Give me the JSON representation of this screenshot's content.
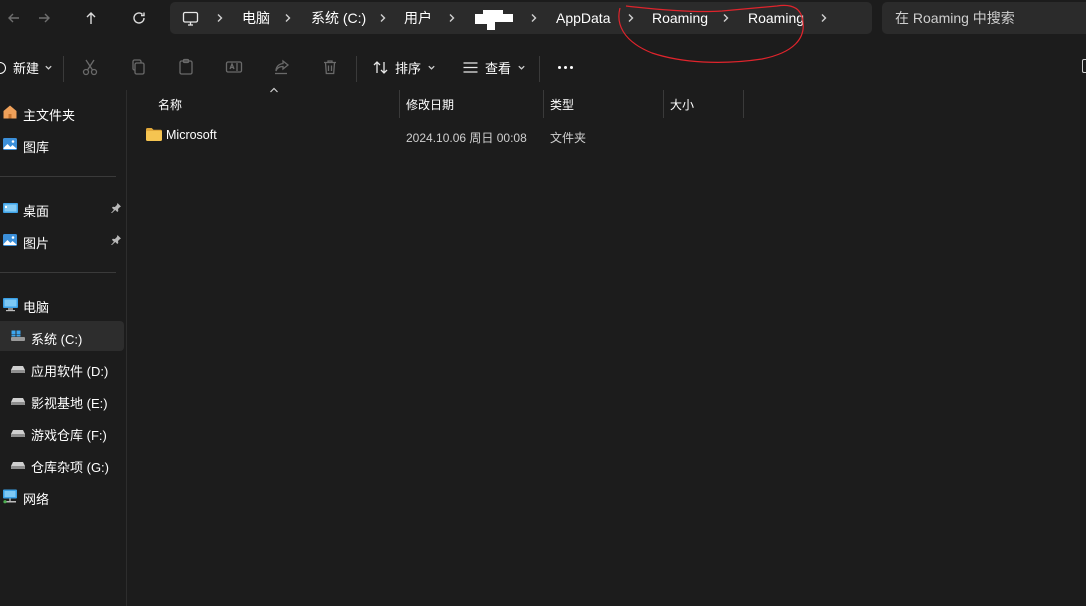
{
  "nav": {
    "back_icon": "arrow-left-icon",
    "forward_icon": "arrow-right-icon",
    "up_icon": "arrow-up-icon",
    "refresh_icon": "refresh-icon"
  },
  "breadcrumb": {
    "root_icon": "monitor-icon",
    "items": [
      "电脑",
      "系统 (C:)",
      "用户",
      "AppData",
      "Roaming",
      "Roaming"
    ],
    "redacted_segment": "username (redacted)"
  },
  "search": {
    "placeholder": "在 Roaming 中搜索"
  },
  "toolbar": {
    "new_label": "新建",
    "sort_label": "排序",
    "view_label": "查看",
    "disabled_icons": [
      "cut-icon",
      "copy-icon",
      "paste-icon",
      "rename-icon",
      "share-icon",
      "delete-icon"
    ],
    "more_icon": "more-icon"
  },
  "sidebar": {
    "quick": [
      {
        "label": "主文件夹",
        "icon": "home-icon"
      },
      {
        "label": "图库",
        "icon": "gallery-icon"
      }
    ],
    "pinned": [
      {
        "label": "桌面",
        "icon": "desktop-icon"
      },
      {
        "label": "图片",
        "icon": "pictures-icon"
      }
    ],
    "pc": {
      "label": "电脑",
      "icon": "computer-icon"
    },
    "drives": [
      {
        "label": "系统 (C:)",
        "selected": true
      },
      {
        "label": "应用软件 (D:)"
      },
      {
        "label": "影视基地 (E:)"
      },
      {
        "label": "游戏仓库 (F:)"
      },
      {
        "label": "仓库杂项 (G:)"
      }
    ],
    "network": {
      "label": "网络",
      "icon": "network-icon"
    }
  },
  "filelist": {
    "columns": [
      "名称",
      "修改日期",
      "类型",
      "大小"
    ],
    "rows": [
      {
        "name": "Microsoft",
        "modified": "2024.10.06 周日 00:08",
        "type": "文件夹",
        "size": ""
      }
    ]
  },
  "colors": {
    "background": "#1c1c1c",
    "panel": "#2b2b2b",
    "selected": "#2d2d2d",
    "annotation": "#e0242c",
    "folder": "#f5c451"
  }
}
